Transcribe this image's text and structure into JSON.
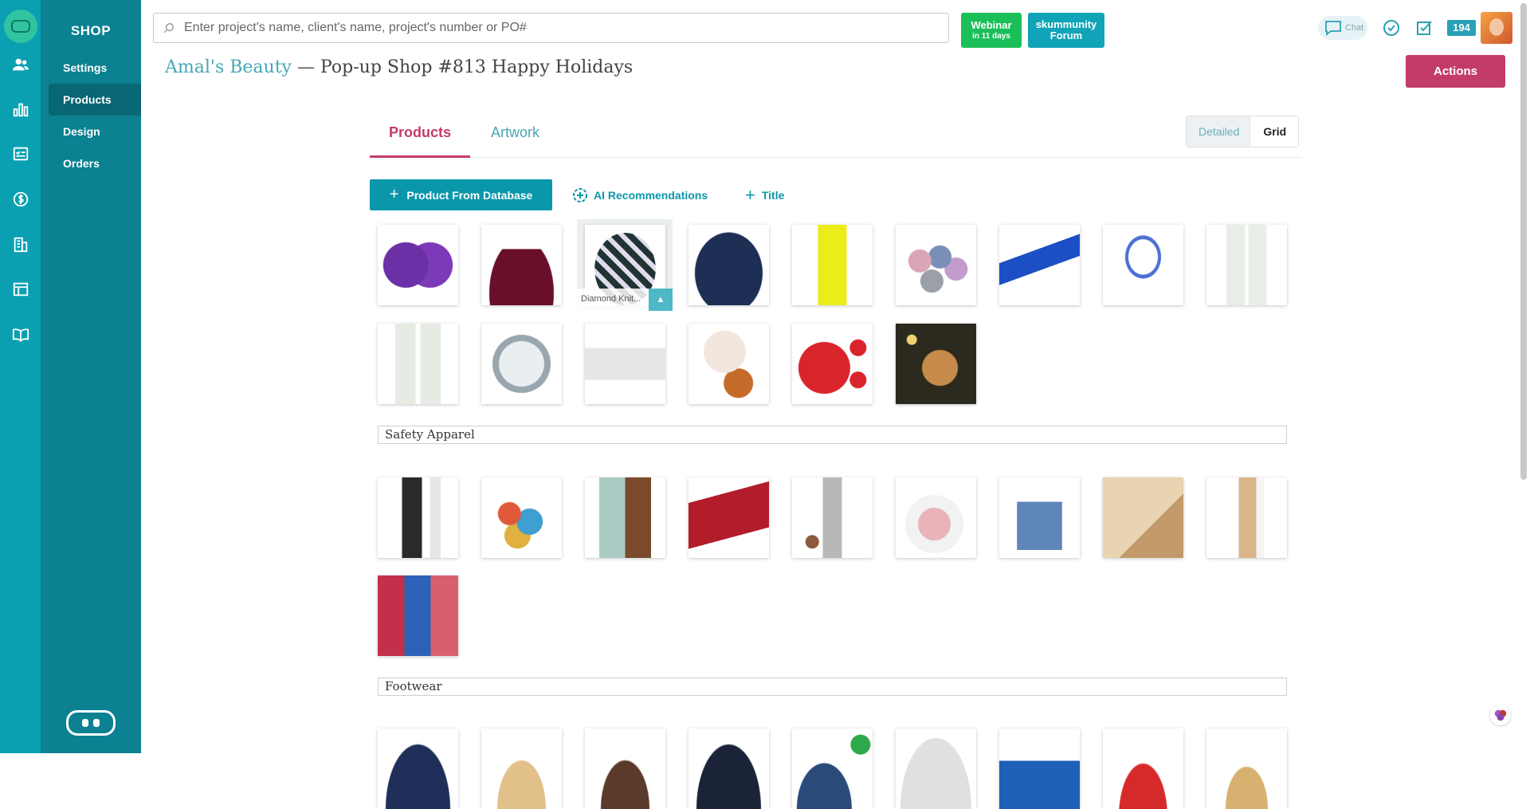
{
  "app": {
    "section_title": "SHOP",
    "nav": [
      {
        "label": "Settings"
      },
      {
        "label": "Products"
      },
      {
        "label": "Design"
      },
      {
        "label": "Orders"
      }
    ]
  },
  "search": {
    "placeholder": "Enter project's name, client's name, project's number or PO#"
  },
  "promos": {
    "webinar_title": "Webinar",
    "webinar_sub": "in 11 days",
    "forum_line1": "skummunity",
    "forum_line2": "Forum"
  },
  "header": {
    "chat_label": "Chat",
    "notification_count": "194"
  },
  "breadcrumb": {
    "client": "Amal's Beauty",
    "separator": " — ",
    "project": "Pop-up Shop #813 Happy Holidays"
  },
  "actions_label": "Actions",
  "tabs": {
    "products": "Products",
    "artwork": "Artwork"
  },
  "view_toggle": {
    "detailed": "Detailed",
    "grid": "Grid"
  },
  "toolbar": {
    "add_product": "Product From Database",
    "ai_recommendations": "AI Recommendations",
    "add_title": "Title"
  },
  "hover_caption": "Diamond Knit...",
  "sections": [
    {
      "title": "Safety Apparel"
    },
    {
      "title": "Footwear"
    }
  ],
  "colors": {
    "rail": "#0aa0b2",
    "sidebar": "#0b8191",
    "accent": "#c33c68",
    "teal": "#0b97aa"
  }
}
